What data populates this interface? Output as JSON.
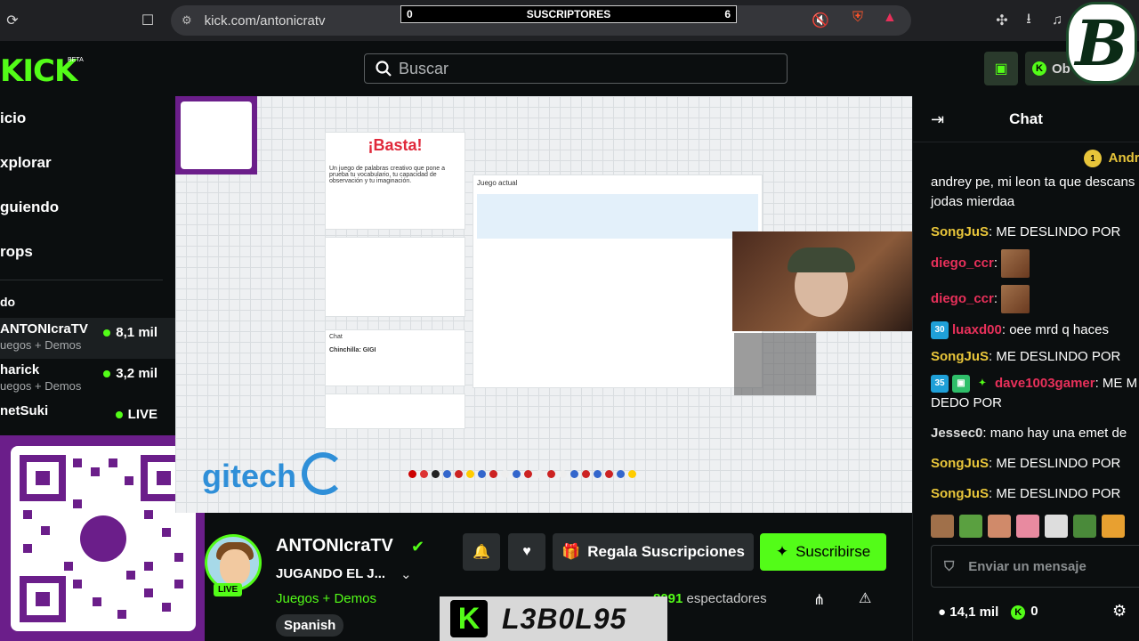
{
  "browser": {
    "url": "kick.com/antonicratv",
    "subs_overlay": {
      "left": "0",
      "title": "SUSCRIPTORES",
      "right": "6"
    }
  },
  "header": {
    "logo": "KICK",
    "logo_tag": "BETA",
    "search_placeholder": "Buscar",
    "objectives_label": "Ob"
  },
  "sidebar": {
    "nav": [
      "icio",
      "xplorar",
      "guiendo",
      "rops"
    ],
    "section": "do",
    "channels": [
      {
        "name": "ANTONIcraTV",
        "category": "uegos + Demos",
        "viewers": "8,1 mil",
        "active": true
      },
      {
        "name": "harick",
        "category": "uegos + Demos",
        "viewers": "3,2 mil",
        "active": false
      },
      {
        "name": "netSuki",
        "category": "",
        "viewers": "LIVE",
        "active": false
      }
    ]
  },
  "video": {
    "game_title": "¡Basta!",
    "logitech_text": "gitech",
    "game_desc": "Un juego de palabras creativo que pone a prueba tu vocabulario, tu capacidad de observación y tu imaginación.",
    "current_game_label": "Juego actual",
    "chat_label": "Chat",
    "chat_line": "Chinchilla: GIGI"
  },
  "channel": {
    "name": "ANTONIcraTV",
    "title": "JUGANDO EL J...",
    "category": "Juegos + Demos",
    "language": "Spanish",
    "live_label": "LIVE",
    "gift_label": "Regala Suscripciones",
    "subscribe_label": "Suscribirse",
    "viewers_count": "8091",
    "viewers_label": "espectadores",
    "overlay_tag": "L3B0L95"
  },
  "chat": {
    "title": "Chat",
    "top_user": "Andre",
    "messages": [
      {
        "user": "",
        "text": "andrey pe, mi leon ta que descans"
      },
      {
        "user": "",
        "text": "jodas mierdaa"
      },
      {
        "user": "SongJuS",
        "text": " ME DESLINDO POR"
      },
      {
        "user": "diego_ccr",
        "text": ""
      },
      {
        "user": "diego_ccr",
        "text": ""
      },
      {
        "user": "luaxd00",
        "text": " oee mrd q haces",
        "badge": "30"
      },
      {
        "user": "SongJuS",
        "text": " ME DESLINDO POR"
      },
      {
        "user": "dave1003gamer",
        "text": " ME M",
        "badge": "35"
      },
      {
        "user": "",
        "text": "DEDO POR"
      },
      {
        "user": "Jessec0",
        "text": " mano hay una emet de"
      },
      {
        "user": "SongJuS",
        "text": " ME DESLINDO POR"
      },
      {
        "user": "SongJuS",
        "text": " ME DESLINDO POR"
      }
    ],
    "input_placeholder": "Enviar un mensaje",
    "footer_count": "14,1 mil",
    "footer_coins": "0"
  },
  "colors": {
    "accent": "#53fc18",
    "bg": "#0b0e0f",
    "panel": "#2a2e30"
  }
}
